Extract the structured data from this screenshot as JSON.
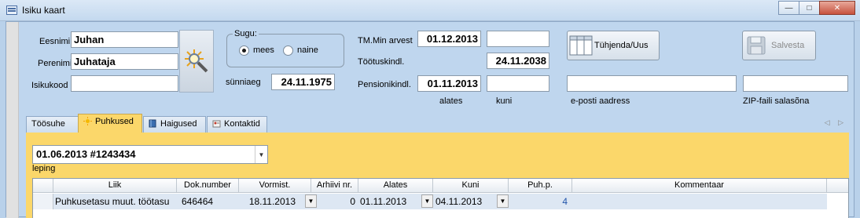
{
  "window": {
    "title": "Isiku kaart",
    "min_glyph": "—",
    "max_glyph": "□",
    "close_glyph": "✕"
  },
  "person": {
    "eesnimi_label": "Eesnimi",
    "eesnimi": "Juhan",
    "perenimi_label": "Perenimi",
    "perenimi": "Juhataja",
    "isikukood_label": "Isikukood",
    "isikukood": "",
    "sunniaeg_label": "sünniaeg",
    "sunniaeg": "24.11.1975"
  },
  "sugu": {
    "legend": "Sugu:",
    "options": [
      "mees",
      "naine"
    ],
    "selected": "mees"
  },
  "employment": {
    "tm_label": "TM.Min arvest",
    "tm_alates": "01.12.2013",
    "tm_kuni": "",
    "tootuskindl_label": "Töötuskindl.",
    "tootuskindl": "24.11.2038",
    "pension_label": "Pensionikindl.",
    "pension_alates": "01.11.2013",
    "pension_kuni": "",
    "alates_label": "alates",
    "kuni_label": "kuni",
    "email_label": "e-posti aadress",
    "email": "",
    "zip_label": "ZIP-faili salasõna",
    "zip": ""
  },
  "buttons": {
    "clear": "Tühjenda/Uus",
    "save": "Salvesta"
  },
  "tabs": [
    {
      "label": "Töösuhe",
      "icon": "none"
    },
    {
      "label": "Puhkused",
      "icon": "sun-icon",
      "active": true
    },
    {
      "label": "Haigused",
      "icon": "book-icon"
    },
    {
      "label": "Kontaktid",
      "icon": "contacts-icon"
    }
  ],
  "tab_arrows": "◁ ▷",
  "leping": {
    "value": "01.06.2013 #1243434",
    "label": "leping"
  },
  "grid": {
    "columns": [
      "Liik",
      "Dok.number",
      "Vormist.",
      "Arhiivi nr.",
      "Alates",
      "Kuni",
      "Puh.p.",
      "Kommentaar"
    ],
    "rows": [
      {
        "liik": "Puhkusetasu muut. töötasu",
        "dok": "646464",
        "vormist": "18.11.2013",
        "arhiivi": "0",
        "alates": "01.11.2013",
        "kuni": "04.11.2013",
        "puhp": "4",
        "kommentaar": ""
      }
    ]
  },
  "colors": {
    "accent": "#fbd76a",
    "background": "#bfd6ee",
    "link": "#2255aa"
  }
}
